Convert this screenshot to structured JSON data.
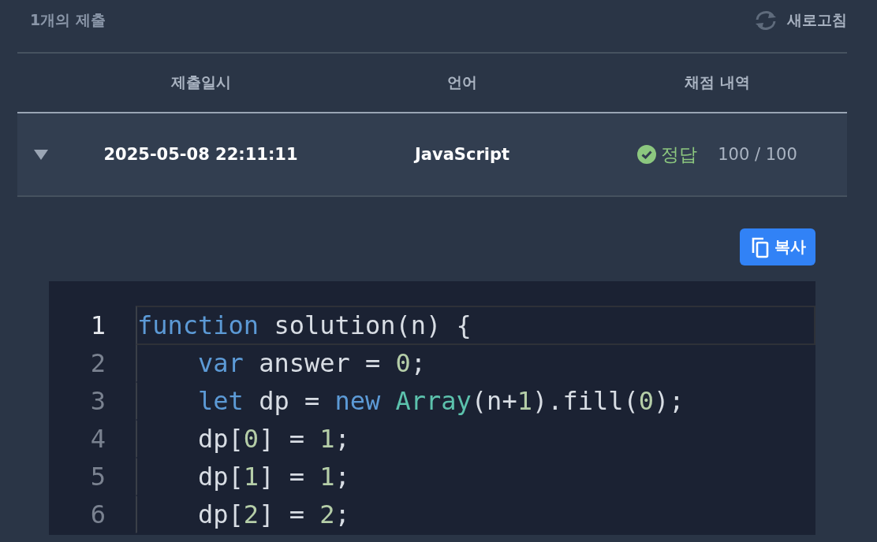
{
  "header": {
    "count": "1개의 제출",
    "refresh": "새로고침"
  },
  "table": {
    "columns": [
      "제출일시",
      "언어",
      "채점 내역"
    ],
    "rows": [
      {
        "expanded": true,
        "date": "2025-05-08 22:11:11",
        "language": "JavaScript",
        "result": "정답",
        "passed": true,
        "score": "100 / 100"
      }
    ]
  },
  "copy_button": "복사",
  "code": {
    "lines": [
      {
        "number": "1",
        "active": true,
        "indented": false,
        "tokens": [
          {
            "kind": "keyword",
            "text": "function"
          },
          {
            "kind": "plain",
            "text": " solution(n) {"
          }
        ]
      },
      {
        "number": "2",
        "active": false,
        "indented": true,
        "tokens": [
          {
            "kind": "keyword",
            "text": "var"
          },
          {
            "kind": "plain",
            "text": " answer = "
          },
          {
            "kind": "number",
            "text": "0"
          },
          {
            "kind": "plain",
            "text": ";"
          }
        ]
      },
      {
        "number": "3",
        "active": false,
        "indented": true,
        "tokens": [
          {
            "kind": "keyword",
            "text": "let"
          },
          {
            "kind": "plain",
            "text": " dp = "
          },
          {
            "kind": "keyword",
            "text": "new"
          },
          {
            "kind": "type",
            "text": " Array"
          },
          {
            "kind": "plain",
            "text": "(n+"
          },
          {
            "kind": "number",
            "text": "1"
          },
          {
            "kind": "plain",
            "text": ").fill("
          },
          {
            "kind": "number",
            "text": "0"
          },
          {
            "kind": "plain",
            "text": ");"
          }
        ]
      },
      {
        "number": "4",
        "active": false,
        "indented": true,
        "tokens": [
          {
            "kind": "plain",
            "text": "dp["
          },
          {
            "kind": "number",
            "text": "0"
          },
          {
            "kind": "plain",
            "text": "] = "
          },
          {
            "kind": "number",
            "text": "1"
          },
          {
            "kind": "plain",
            "text": ";"
          }
        ]
      },
      {
        "number": "5",
        "active": false,
        "indented": true,
        "tokens": [
          {
            "kind": "plain",
            "text": "dp["
          },
          {
            "kind": "number",
            "text": "1"
          },
          {
            "kind": "plain",
            "text": "] = "
          },
          {
            "kind": "number",
            "text": "1"
          },
          {
            "kind": "plain",
            "text": ";"
          }
        ]
      },
      {
        "number": "6",
        "active": false,
        "indented": true,
        "tokens": [
          {
            "kind": "plain",
            "text": "dp["
          },
          {
            "kind": "number",
            "text": "2"
          },
          {
            "kind": "plain",
            "text": "] = "
          },
          {
            "kind": "number",
            "text": "2"
          },
          {
            "kind": "plain",
            "text": ";"
          }
        ]
      }
    ]
  }
}
